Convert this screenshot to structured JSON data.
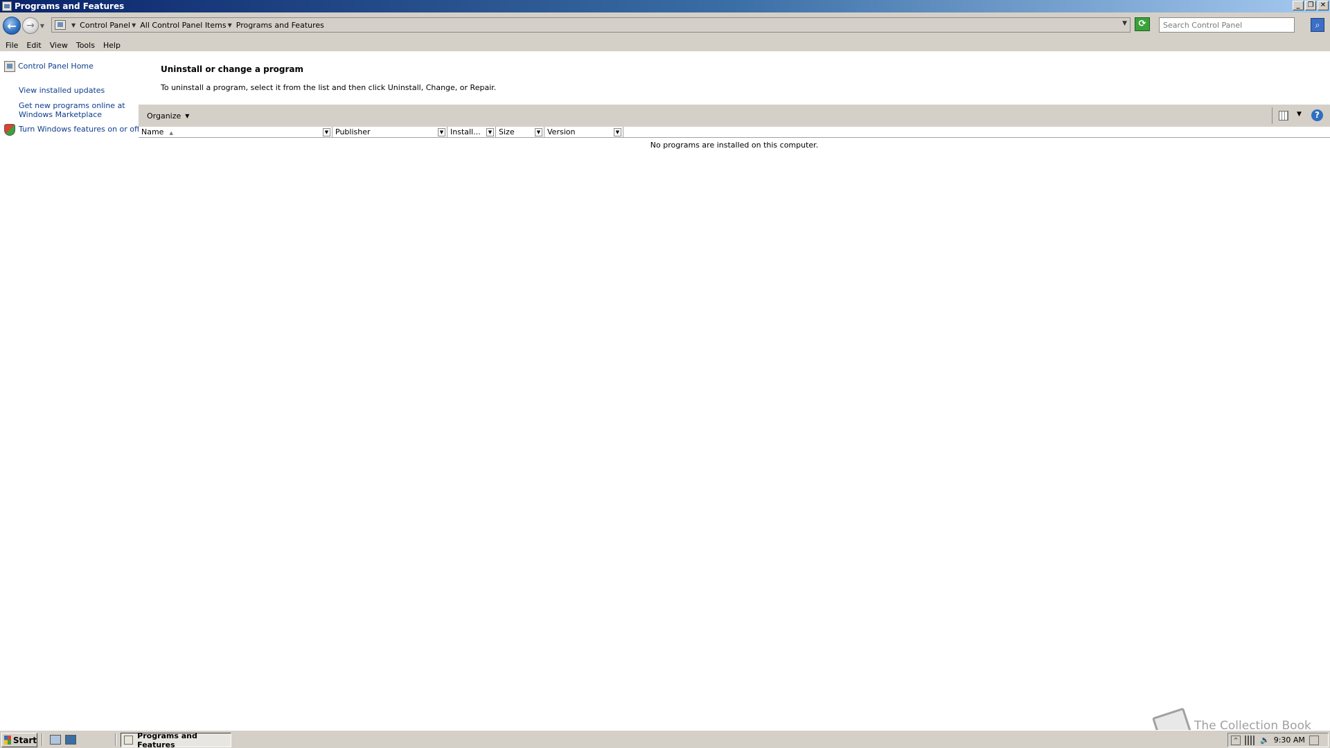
{
  "window": {
    "title": "Programs and Features",
    "controls": {
      "minimize": "_",
      "restore": "❐",
      "close": "✕"
    }
  },
  "address": {
    "breadcrumbs": [
      "Control Panel",
      "All Control Panel Items",
      "Programs and Features"
    ],
    "search_placeholder": "Search Control Panel"
  },
  "menu": [
    "File",
    "Edit",
    "View",
    "Tools",
    "Help"
  ],
  "tasks": {
    "home": "Control Panel Home",
    "updates": "View installed updates",
    "marketplace_line1": "Get new programs online at",
    "marketplace_line2": "Windows Marketplace",
    "features": "Turn Windows features on or off"
  },
  "main": {
    "title": "Uninstall or change a program",
    "description": "To uninstall a program, select it from the list and then click Uninstall, Change, or Repair.",
    "organize": "Organize",
    "columns": [
      "Name",
      "Publisher",
      "Install...",
      "Size",
      "Version"
    ],
    "empty_message": "No programs are installed on this computer."
  },
  "taskbar": {
    "start": "Start",
    "active_task": "Programs and Features",
    "clock": "9:30 AM"
  },
  "watermark": "The Collection Book",
  "icons": {
    "back": "arrow-left-icon",
    "forward": "arrow-right-icon",
    "refresh": "refresh-icon",
    "search": "search-icon",
    "help": "help-icon"
  },
  "colors": {
    "titlebar_start": "#0a246a",
    "titlebar_end": "#a6caf0",
    "chrome": "#d4d0c8",
    "link": "#0c3c8c"
  }
}
